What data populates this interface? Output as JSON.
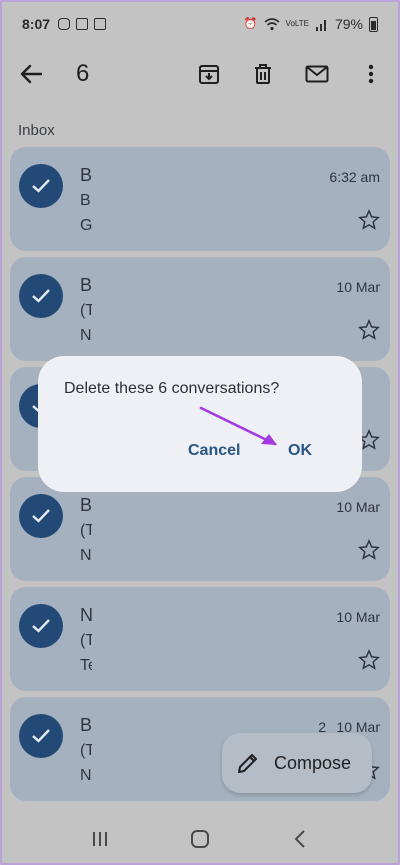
{
  "status_bar": {
    "time": "8:07",
    "network_label": "VoLTE",
    "battery_percent": "79%"
  },
  "toolbar": {
    "selected_count": "6",
    "icons": [
      "back-arrow-icon",
      "archive-icon",
      "trash-icon",
      "mail-icon",
      "more-vert-icon"
    ]
  },
  "section_label": "Inbox",
  "rows": [
    {
      "line1": "B",
      "line2": "B",
      "line3": "G",
      "date": "6:32 am",
      "extra": ""
    },
    {
      "line1": "B",
      "line2": "(T",
      "line3": "N",
      "date": "10 Mar",
      "extra": ""
    },
    {
      "line1": "",
      "line2": "",
      "line3": "",
      "date": "",
      "extra": ""
    },
    {
      "line1": "B",
      "line2": "(T",
      "line3": "N",
      "date": "10 Mar",
      "extra": ""
    },
    {
      "line1": "N",
      "line2": "(T",
      "line3": "Te",
      "date": "10 Mar",
      "extra": ""
    },
    {
      "line1": "B",
      "line2": "(T",
      "line3": "Ni",
      "date": "10 Mar",
      "extra": "2"
    }
  ],
  "dialog": {
    "message": "Delete these 6 conversations?",
    "cancel_label": "Cancel",
    "ok_label": "OK"
  },
  "compose_label": "Compose",
  "colors": {
    "accent": "#2a5582",
    "check": "#234a77",
    "arrow": "#a33be0"
  }
}
